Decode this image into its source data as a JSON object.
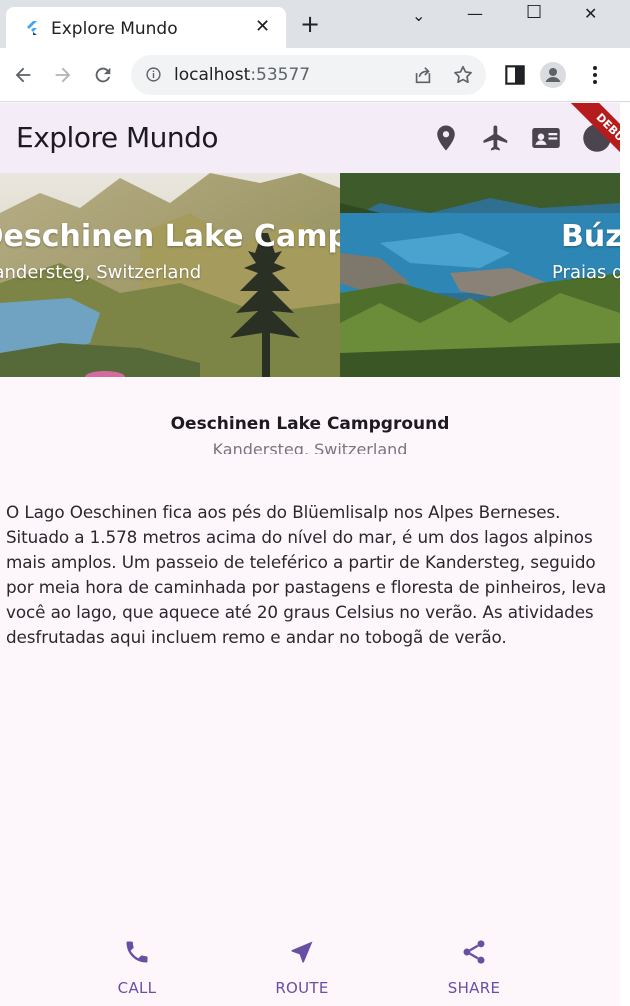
{
  "browser": {
    "tab_title": "Explore Mundo",
    "tab_close": "✕",
    "new_tab": "+",
    "url_host": "localhost",
    "url_port": ":53577",
    "controls": {
      "minimize": "—",
      "restore": "☐",
      "close": "✕",
      "tabsearch": "⌄"
    }
  },
  "app": {
    "title": "Explore Mundo",
    "debug_label": "DEBUG",
    "appbar_icons": [
      "location-pin-icon",
      "airplane-icon",
      "contact-card-icon",
      "account-circle-icon"
    ]
  },
  "carousel": {
    "slides": [
      {
        "title": "Oeschinen Lake Campground",
        "subtitle": "Kandersteg, Switzerland"
      },
      {
        "title": "Búzios",
        "subtitle": "Praias de Búzios"
      }
    ]
  },
  "detail": {
    "title": "Oeschinen Lake Campground",
    "subtitle": "Kandersteg, Switzerland",
    "description": "O Lago Oeschinen fica aos pés do Blüemlisalp nos Alpes Berneses. Situado a 1.578 metros acima do nível do mar, é um dos lagos alpinos mais amplos. Um passeio de teleférico a partir de Kandersteg, seguido por meia hora de caminhada por pastagens e floresta de pinheiros, leva você ao lago, que aquece até 20 graus Celsius no verão. As atividades desfrutadas aqui incluem remo e andar no tobogã de verão."
  },
  "actions": [
    {
      "label": "CALL",
      "icon": "phone-icon"
    },
    {
      "label": "ROUTE",
      "icon": "navigation-arrow-icon"
    },
    {
      "label": "SHARE",
      "icon": "share-icon"
    }
  ],
  "colors": {
    "primary": "#6750a4",
    "appbar": "#f4edf7",
    "background": "#fdf7fc",
    "debug": "#b71c1c"
  }
}
